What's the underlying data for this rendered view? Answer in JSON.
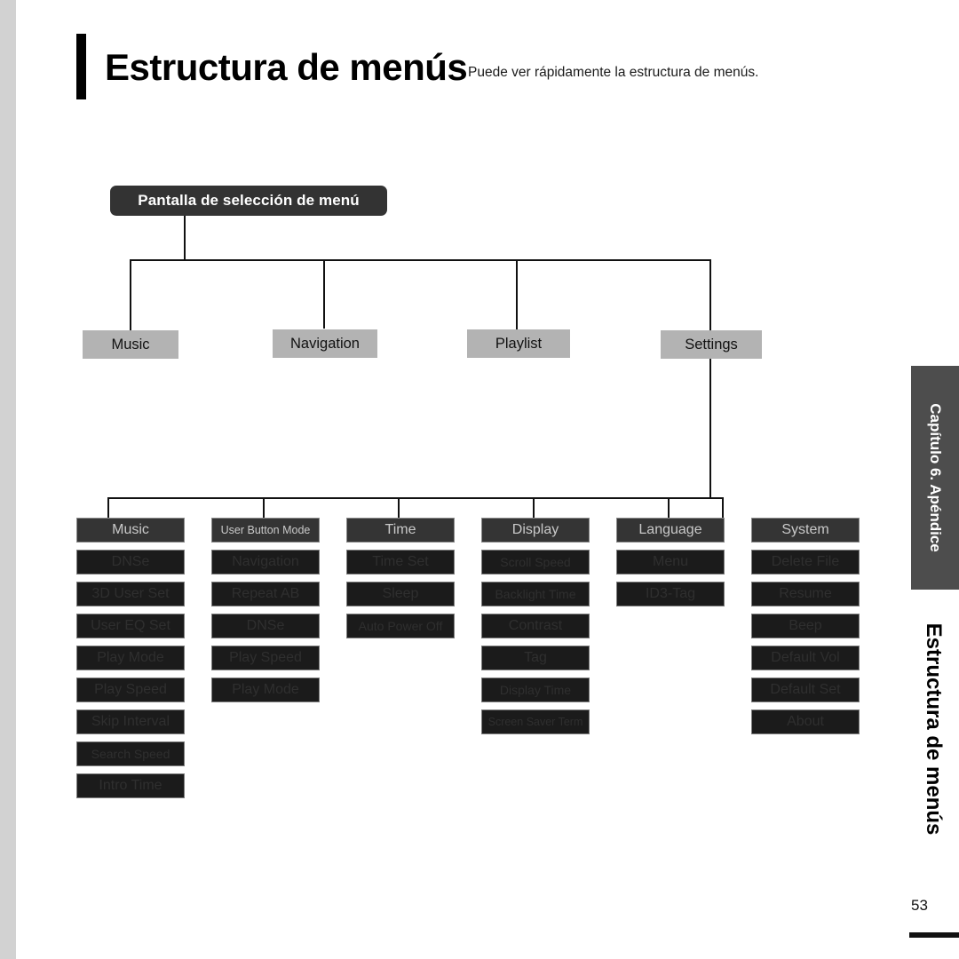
{
  "header": {
    "title": "Estructura de menús",
    "subtitle": "Puede ver rápidamente la estructura de menús."
  },
  "root": {
    "label": "Pantalla de selección de menú"
  },
  "level1": [
    {
      "label": "Music"
    },
    {
      "label": "Navigation"
    },
    {
      "label": "Playlist"
    },
    {
      "label": "Settings"
    }
  ],
  "settings_columns": [
    {
      "header": "Music",
      "items": [
        "DNSe",
        "3D User Set",
        "User EQ Set",
        "Play Mode",
        "Play Speed",
        "Skip Interval",
        "Search Speed",
        "Intro Time"
      ]
    },
    {
      "header": "User Button Mode",
      "items": [
        "Navigation",
        "Repeat AB",
        "DNSe",
        "Play Speed",
        "Play Mode"
      ]
    },
    {
      "header": "Time",
      "items": [
        "Time Set",
        "Sleep",
        "Auto Power Off"
      ]
    },
    {
      "header": "Display",
      "items": [
        "Scroll Speed",
        "Backlight Time",
        "Contrast",
        "Tag",
        "Display Time",
        "Screen Saver Term"
      ]
    },
    {
      "header": "Language",
      "items": [
        "Menu",
        "ID3-Tag"
      ]
    },
    {
      "header": "System",
      "items": [
        "Delete File",
        "Resume",
        "Beep",
        "Default Vol",
        "Default Set",
        "About"
      ]
    }
  ],
  "sidebar": {
    "chapter_tab": "Capítulo 6. Apéndice",
    "section_title": "Estructura de menús"
  },
  "footer": {
    "page_number": "53"
  },
  "colors": {
    "root_box": "#333333",
    "level1_box": "#b3b3b3",
    "column_header": "#343434",
    "column_item": "#1b1b1b",
    "chapter_tab": "#4d4d4d",
    "edge_strip": "#d2d2d2",
    "line": "#111111"
  }
}
